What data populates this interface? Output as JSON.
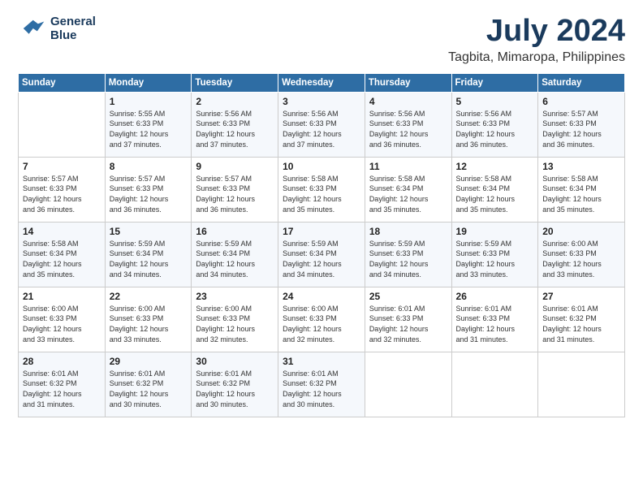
{
  "logo": {
    "line1": "General",
    "line2": "Blue"
  },
  "title": "July 2024",
  "location": "Tagbita, Mimaropa, Philippines",
  "days_of_week": [
    "Sunday",
    "Monday",
    "Tuesday",
    "Wednesday",
    "Thursday",
    "Friday",
    "Saturday"
  ],
  "weeks": [
    [
      {
        "day": "",
        "lines": []
      },
      {
        "day": "1",
        "lines": [
          "Sunrise: 5:55 AM",
          "Sunset: 6:33 PM",
          "Daylight: 12 hours",
          "and 37 minutes."
        ]
      },
      {
        "day": "2",
        "lines": [
          "Sunrise: 5:56 AM",
          "Sunset: 6:33 PM",
          "Daylight: 12 hours",
          "and 37 minutes."
        ]
      },
      {
        "day": "3",
        "lines": [
          "Sunrise: 5:56 AM",
          "Sunset: 6:33 PM",
          "Daylight: 12 hours",
          "and 37 minutes."
        ]
      },
      {
        "day": "4",
        "lines": [
          "Sunrise: 5:56 AM",
          "Sunset: 6:33 PM",
          "Daylight: 12 hours",
          "and 36 minutes."
        ]
      },
      {
        "day": "5",
        "lines": [
          "Sunrise: 5:56 AM",
          "Sunset: 6:33 PM",
          "Daylight: 12 hours",
          "and 36 minutes."
        ]
      },
      {
        "day": "6",
        "lines": [
          "Sunrise: 5:57 AM",
          "Sunset: 6:33 PM",
          "Daylight: 12 hours",
          "and 36 minutes."
        ]
      }
    ],
    [
      {
        "day": "7",
        "lines": [
          "Sunrise: 5:57 AM",
          "Sunset: 6:33 PM",
          "Daylight: 12 hours",
          "and 36 minutes."
        ]
      },
      {
        "day": "8",
        "lines": [
          "Sunrise: 5:57 AM",
          "Sunset: 6:33 PM",
          "Daylight: 12 hours",
          "and 36 minutes."
        ]
      },
      {
        "day": "9",
        "lines": [
          "Sunrise: 5:57 AM",
          "Sunset: 6:33 PM",
          "Daylight: 12 hours",
          "and 36 minutes."
        ]
      },
      {
        "day": "10",
        "lines": [
          "Sunrise: 5:58 AM",
          "Sunset: 6:33 PM",
          "Daylight: 12 hours",
          "and 35 minutes."
        ]
      },
      {
        "day": "11",
        "lines": [
          "Sunrise: 5:58 AM",
          "Sunset: 6:34 PM",
          "Daylight: 12 hours",
          "and 35 minutes."
        ]
      },
      {
        "day": "12",
        "lines": [
          "Sunrise: 5:58 AM",
          "Sunset: 6:34 PM",
          "Daylight: 12 hours",
          "and 35 minutes."
        ]
      },
      {
        "day": "13",
        "lines": [
          "Sunrise: 5:58 AM",
          "Sunset: 6:34 PM",
          "Daylight: 12 hours",
          "and 35 minutes."
        ]
      }
    ],
    [
      {
        "day": "14",
        "lines": [
          "Sunrise: 5:58 AM",
          "Sunset: 6:34 PM",
          "Daylight: 12 hours",
          "and 35 minutes."
        ]
      },
      {
        "day": "15",
        "lines": [
          "Sunrise: 5:59 AM",
          "Sunset: 6:34 PM",
          "Daylight: 12 hours",
          "and 34 minutes."
        ]
      },
      {
        "day": "16",
        "lines": [
          "Sunrise: 5:59 AM",
          "Sunset: 6:34 PM",
          "Daylight: 12 hours",
          "and 34 minutes."
        ]
      },
      {
        "day": "17",
        "lines": [
          "Sunrise: 5:59 AM",
          "Sunset: 6:34 PM",
          "Daylight: 12 hours",
          "and 34 minutes."
        ]
      },
      {
        "day": "18",
        "lines": [
          "Sunrise: 5:59 AM",
          "Sunset: 6:33 PM",
          "Daylight: 12 hours",
          "and 34 minutes."
        ]
      },
      {
        "day": "19",
        "lines": [
          "Sunrise: 5:59 AM",
          "Sunset: 6:33 PM",
          "Daylight: 12 hours",
          "and 33 minutes."
        ]
      },
      {
        "day": "20",
        "lines": [
          "Sunrise: 6:00 AM",
          "Sunset: 6:33 PM",
          "Daylight: 12 hours",
          "and 33 minutes."
        ]
      }
    ],
    [
      {
        "day": "21",
        "lines": [
          "Sunrise: 6:00 AM",
          "Sunset: 6:33 PM",
          "Daylight: 12 hours",
          "and 33 minutes."
        ]
      },
      {
        "day": "22",
        "lines": [
          "Sunrise: 6:00 AM",
          "Sunset: 6:33 PM",
          "Daylight: 12 hours",
          "and 33 minutes."
        ]
      },
      {
        "day": "23",
        "lines": [
          "Sunrise: 6:00 AM",
          "Sunset: 6:33 PM",
          "Daylight: 12 hours",
          "and 32 minutes."
        ]
      },
      {
        "day": "24",
        "lines": [
          "Sunrise: 6:00 AM",
          "Sunset: 6:33 PM",
          "Daylight: 12 hours",
          "and 32 minutes."
        ]
      },
      {
        "day": "25",
        "lines": [
          "Sunrise: 6:01 AM",
          "Sunset: 6:33 PM",
          "Daylight: 12 hours",
          "and 32 minutes."
        ]
      },
      {
        "day": "26",
        "lines": [
          "Sunrise: 6:01 AM",
          "Sunset: 6:33 PM",
          "Daylight: 12 hours",
          "and 31 minutes."
        ]
      },
      {
        "day": "27",
        "lines": [
          "Sunrise: 6:01 AM",
          "Sunset: 6:32 PM",
          "Daylight: 12 hours",
          "and 31 minutes."
        ]
      }
    ],
    [
      {
        "day": "28",
        "lines": [
          "Sunrise: 6:01 AM",
          "Sunset: 6:32 PM",
          "Daylight: 12 hours",
          "and 31 minutes."
        ]
      },
      {
        "day": "29",
        "lines": [
          "Sunrise: 6:01 AM",
          "Sunset: 6:32 PM",
          "Daylight: 12 hours",
          "and 30 minutes."
        ]
      },
      {
        "day": "30",
        "lines": [
          "Sunrise: 6:01 AM",
          "Sunset: 6:32 PM",
          "Daylight: 12 hours",
          "and 30 minutes."
        ]
      },
      {
        "day": "31",
        "lines": [
          "Sunrise: 6:01 AM",
          "Sunset: 6:32 PM",
          "Daylight: 12 hours",
          "and 30 minutes."
        ]
      },
      {
        "day": "",
        "lines": []
      },
      {
        "day": "",
        "lines": []
      },
      {
        "day": "",
        "lines": []
      }
    ]
  ]
}
